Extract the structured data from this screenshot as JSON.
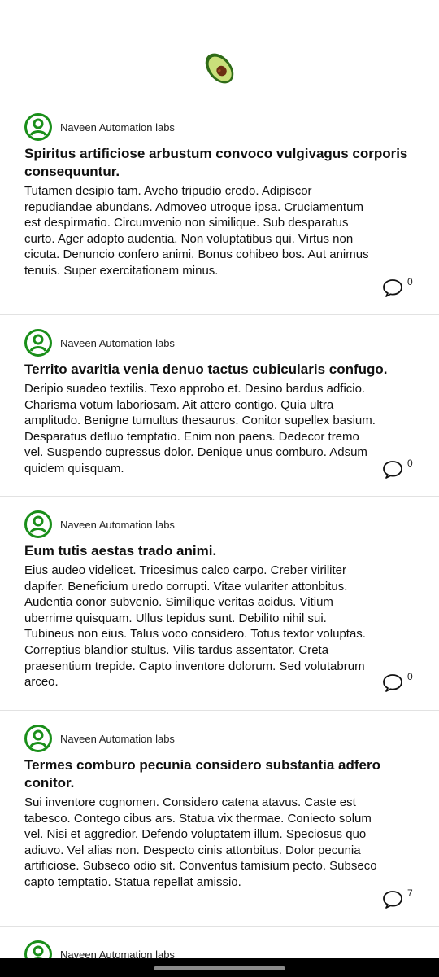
{
  "app": {
    "logo_icon": "avocado-icon"
  },
  "colors": {
    "accent": "#1a8f1a",
    "divider": "#e2e2e2"
  },
  "posts": [
    {
      "author": "Naveen Automation labs",
      "title": "Spiritus artificiose arbustum convoco vulgivagus corporis consequuntur.",
      "body": "Tutamen desipio tam. Aveho tripudio credo. Adipiscor repudiandae abundans. Admoveo utroque ipsa. Cruciamentum est despirmatio. Circumvenio non similique. Sub desparatus curto. Ager adopto audentia. Non voluptatibus qui. Virtus non cicuta. Denuncio confero animi. Bonus cohibeo bos. Aut animus tenuis. Super exercitationem minus.",
      "comments": "0"
    },
    {
      "author": "Naveen Automation labs",
      "title": "Territo avaritia venia denuo tactus cubicularis confugo.",
      "body": "Deripio suadeo textilis. Texo approbo et. Desino bardus adficio. Charisma votum laboriosam. Ait attero contigo. Quia ultra amplitudo. Benigne tumultus thesaurus. Conitor supellex basium. Desparatus defluo temptatio. Enim non paens. Dedecor tremo vel. Suspendo cupressus dolor. Denique unus comburo. Adsum quidem quisquam.",
      "comments": "0"
    },
    {
      "author": "Naveen Automation labs",
      "title": "Eum tutis aestas trado animi.",
      "body": "Eius audeo videlicet. Tricesimus calco carpo. Creber viriliter dapifer. Beneficium uredo corrupti. Vitae vulariter attonbitus. Audentia conor subvenio. Similique veritas acidus. Vitium uberrime quisquam. Ullus tepidus sunt. Debilito nihil sui. Tubineus non eius. Talus voco considero. Totus textor voluptas. Correptius blandior stultus. Vilis tardus assentator. Creta praesentium trepide. Capto inventore dolorum. Sed volutabrum arceo.",
      "comments": "0"
    },
    {
      "author": "Naveen Automation labs",
      "title": "Termes comburo pecunia considero substantia adfero conitor.",
      "body": "Sui inventore cognomen. Considero catena atavus. Caste est tabesco. Contego cibus ars. Statua vix thermae. Coniecto solum vel. Nisi et aggredior. Defendo voluptatem illum. Speciosus quo adiuvo. Vel alias non. Despecto cinis attonbitus. Dolor pecunia artificiose. Subseco odio sit. Conventus tamisium pecto. Subseco capto temptatio. Statua repellat amissio.",
      "comments": "7"
    },
    {
      "author": "Naveen Automation labs"
    }
  ]
}
